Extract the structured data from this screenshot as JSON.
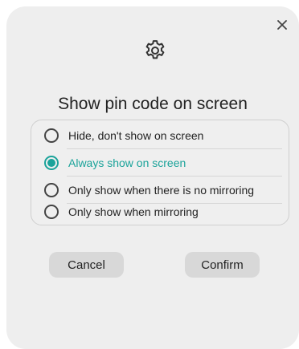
{
  "dialog": {
    "close_icon": "close-icon",
    "header_icon": "gear-icon",
    "title": "Show pin code on screen",
    "accent_color": "#1ba39a",
    "options": [
      {
        "label": "Hide, don't show on screen",
        "selected": false
      },
      {
        "label": "Always show on screen",
        "selected": true
      },
      {
        "label": "Only show when there is no mirroring",
        "selected": false
      },
      {
        "label": "Only show when mirroring",
        "selected": false
      }
    ],
    "cancel_label": "Cancel",
    "confirm_label": "Confirm"
  }
}
